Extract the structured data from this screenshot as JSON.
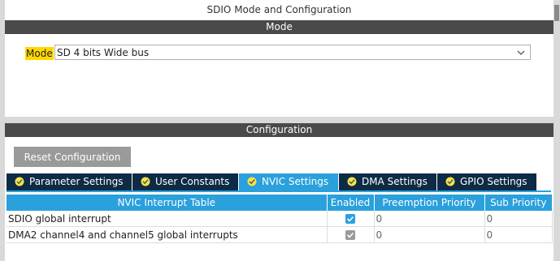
{
  "top_panel": {
    "title": "SDIO Mode and Configuration",
    "section": "Mode",
    "mode_label": "Mode",
    "mode_value": "SD 4 bits Wide bus"
  },
  "config": {
    "section": "Configuration",
    "reset_button": "Reset Configuration",
    "tabs": [
      {
        "label": "Parameter Settings",
        "active": false
      },
      {
        "label": "User Constants",
        "active": false
      },
      {
        "label": "NVIC Settings",
        "active": true
      },
      {
        "label": "DMA Settings",
        "active": false
      },
      {
        "label": "GPIO Settings",
        "active": false
      }
    ],
    "table": {
      "headers": [
        "NVIC Interrupt Table",
        "Enabled",
        "Preemption Priority",
        "Sub Priority"
      ],
      "rows": [
        {
          "name": "SDIO global interrupt",
          "enabled": true,
          "preemption": "0",
          "sub": "0"
        },
        {
          "name": "DMA2 channel4 and channel5 global interrupts",
          "enabled": true,
          "preemption": "0",
          "sub": "0"
        }
      ]
    }
  },
  "colors": {
    "accent": "#2aa0dc",
    "tab_dark": "#0d2b45",
    "section_bar": "#4a4a4a",
    "mode_highlight": "#ffd700"
  },
  "icons": {
    "tab": "check-circle-icon",
    "select": "chevron-down-icon",
    "checkbox": "check-icon"
  }
}
